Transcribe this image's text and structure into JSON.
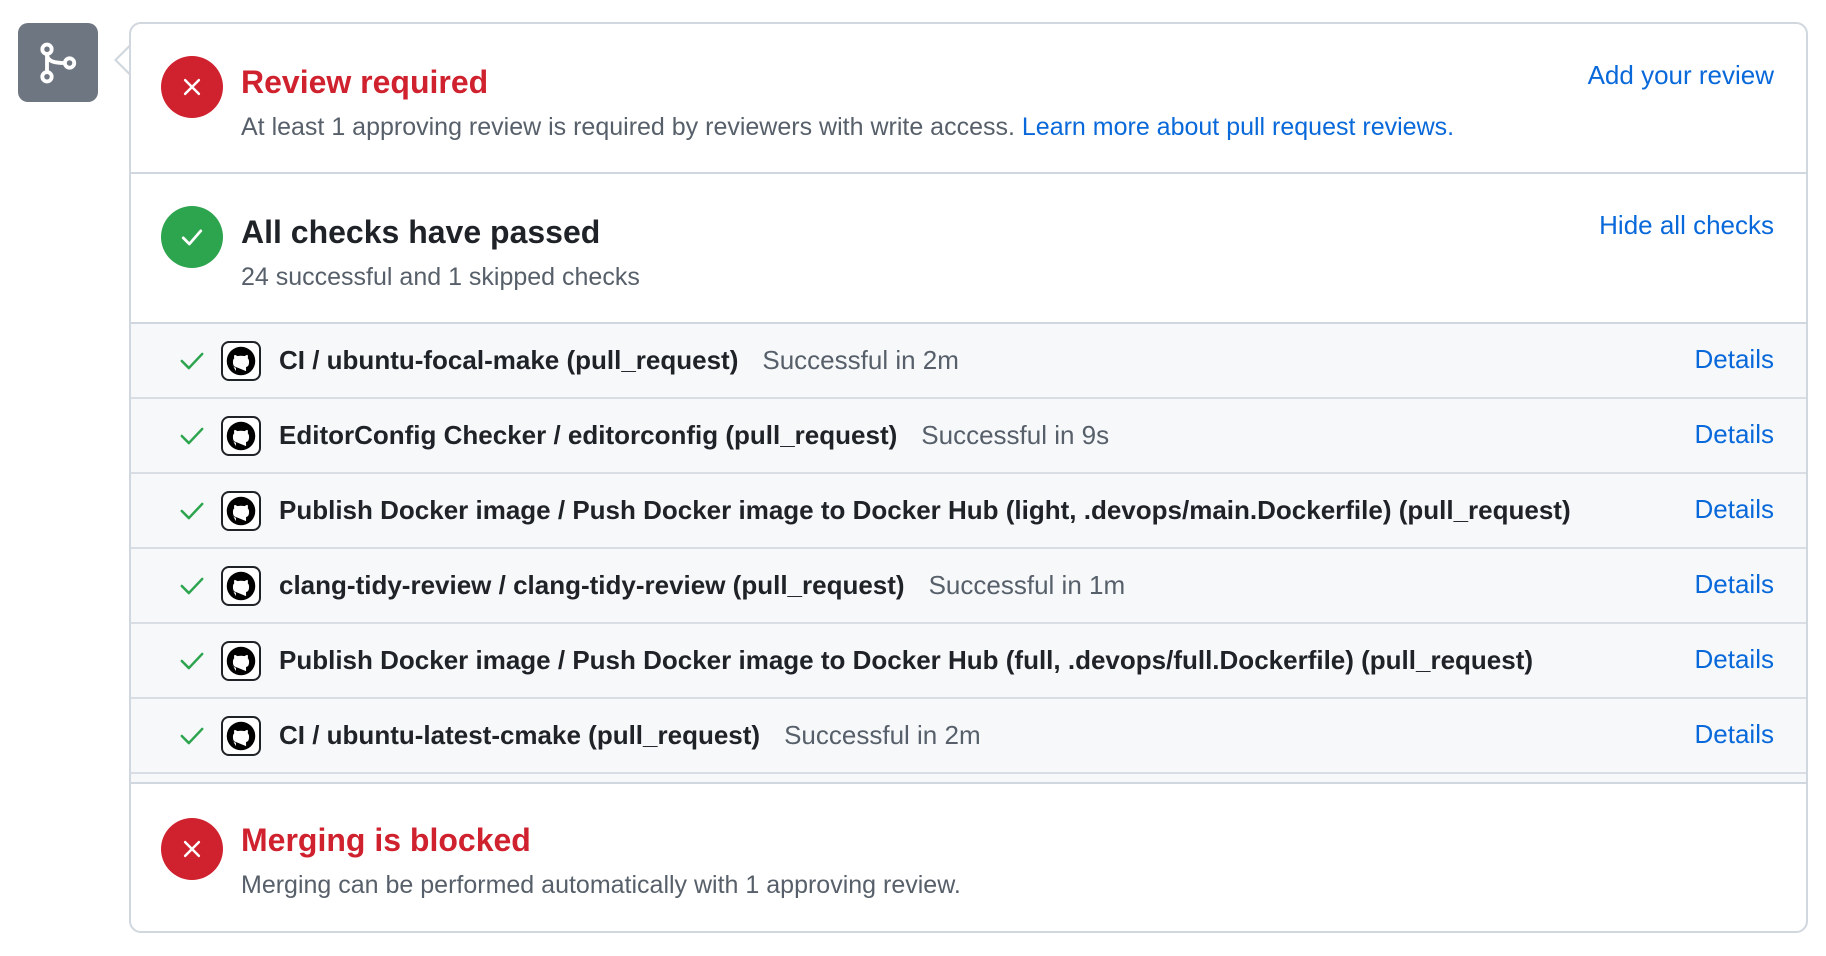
{
  "colors": {
    "danger": "#cf222e",
    "success": "#2da44e",
    "link": "#0969da",
    "muted": "#57606a",
    "badge": "#6e7781"
  },
  "merge_icon": "git-merge-icon",
  "review": {
    "icon": "x-icon",
    "title": "Review required",
    "desc": "At least 1 approving review is required by reviewers with write access.",
    "learn_more": "Learn more about pull request reviews.",
    "action": "Add your review"
  },
  "checks": {
    "icon": "check-icon",
    "title": "All checks have passed",
    "summary": "24 successful and 1 skipped checks",
    "action": "Hide all checks",
    "items": [
      {
        "name": "CI / ubuntu-focal-make (pull_request)",
        "status": "Successful in 2m",
        "details": "Details"
      },
      {
        "name": "EditorConfig Checker / editorconfig (pull_request)",
        "status": "Successful in 9s",
        "details": "Details"
      },
      {
        "name": "Publish Docker image / Push Docker image to Docker Hub (light, .devops/main.Dockerfile) (pull_request)",
        "status": "",
        "details": "Details"
      },
      {
        "name": "clang-tidy-review / clang-tidy-review (pull_request)",
        "status": "Successful in 1m",
        "details": "Details"
      },
      {
        "name": "Publish Docker image / Push Docker image to Docker Hub (full, .devops/full.Dockerfile) (pull_request)",
        "status": "",
        "details": "Details"
      },
      {
        "name": "CI / ubuntu-latest-cmake (pull_request)",
        "status": "Successful in 2m",
        "details": "Details"
      }
    ]
  },
  "merge": {
    "icon": "x-icon",
    "title": "Merging is blocked",
    "desc": "Merging can be performed automatically with 1 approving review."
  }
}
